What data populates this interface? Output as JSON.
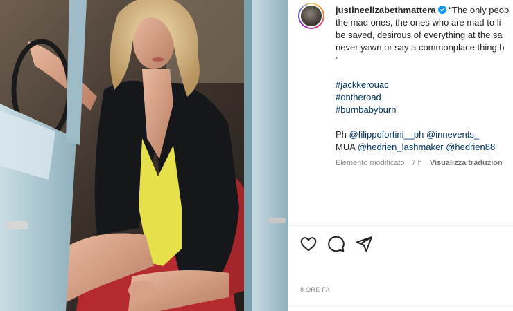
{
  "post": {
    "username": "justineelizabethmattera",
    "caption_lines": [
      "“The only peop",
      "the mad ones, the ones who are mad to li",
      "be saved, desirous of everything at the sa",
      "never yawn or say a commonplace thing b",
      "”"
    ],
    "hashtags": [
      "#jackkerouac",
      "#ontheroad",
      "#burnbabyburn"
    ],
    "credits": {
      "ph_prefix": "Ph ",
      "ph_handles": [
        "@filippofortini__ph",
        "@innevents_"
      ],
      "mua_prefix": "MUA ",
      "mua_handles": [
        "@hedrien_lashmaker",
        "@hedrien88"
      ]
    },
    "edited_label": "Elemento modificato",
    "edited_time": "· 7 h",
    "translate_label": "Visualizza traduzion",
    "timestamp": "8 ORE FA"
  },
  "icons": {
    "like": "heart-icon",
    "comment": "comment-icon",
    "share": "send-icon",
    "verified": "verified-badge-icon"
  },
  "colors": {
    "link": "#00376b",
    "verified": "#0095f6",
    "muted": "#8e8e8e",
    "text": "#262626",
    "swimsuit": "#e6e04a",
    "car_body": "#a9c7d2"
  }
}
